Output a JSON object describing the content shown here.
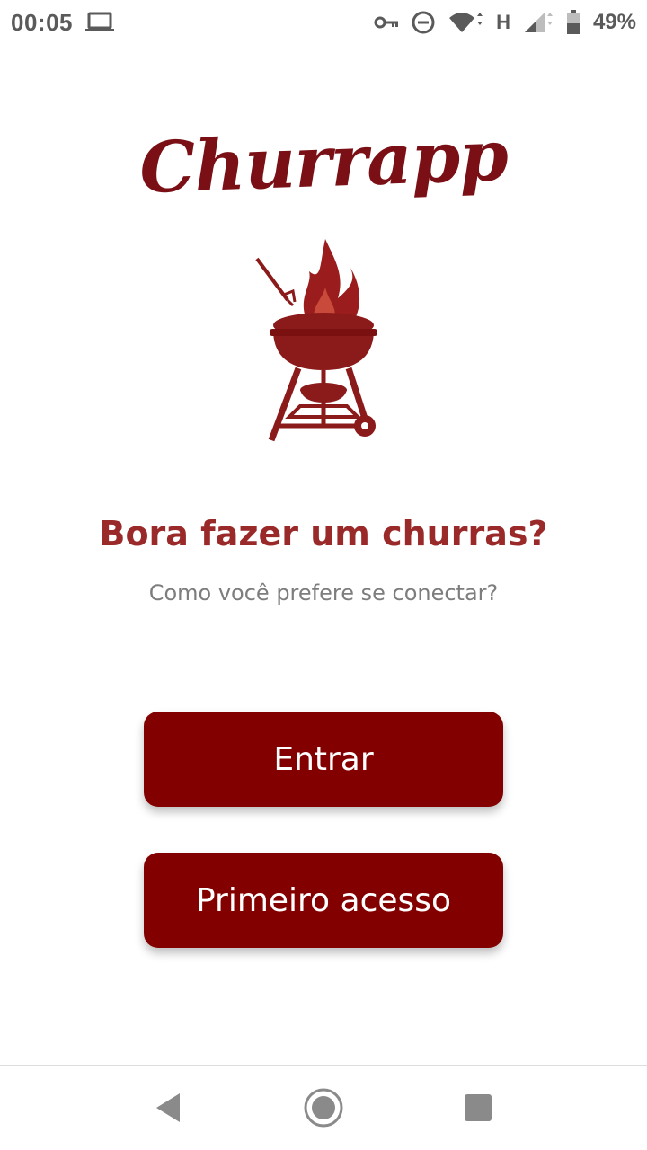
{
  "status_bar": {
    "time": "00:05",
    "network_type": "H",
    "battery_percent": "49%",
    "icons": [
      "laptop-icon",
      "key-icon",
      "do-not-disturb-icon",
      "wifi-icon",
      "signal-icon",
      "battery-icon"
    ]
  },
  "app": {
    "logo_text": "Churrapp",
    "logo_icon": "grill-icon",
    "brand_color": "#830000",
    "headline": "Bora fazer um churras?",
    "subheadline": "Como você prefere se conectar?"
  },
  "buttons": {
    "login_label": "Entrar",
    "first_access_label": "Primeiro acesso"
  },
  "nav_bar": {
    "icons": [
      "back-icon",
      "home-icon",
      "recents-icon"
    ]
  }
}
